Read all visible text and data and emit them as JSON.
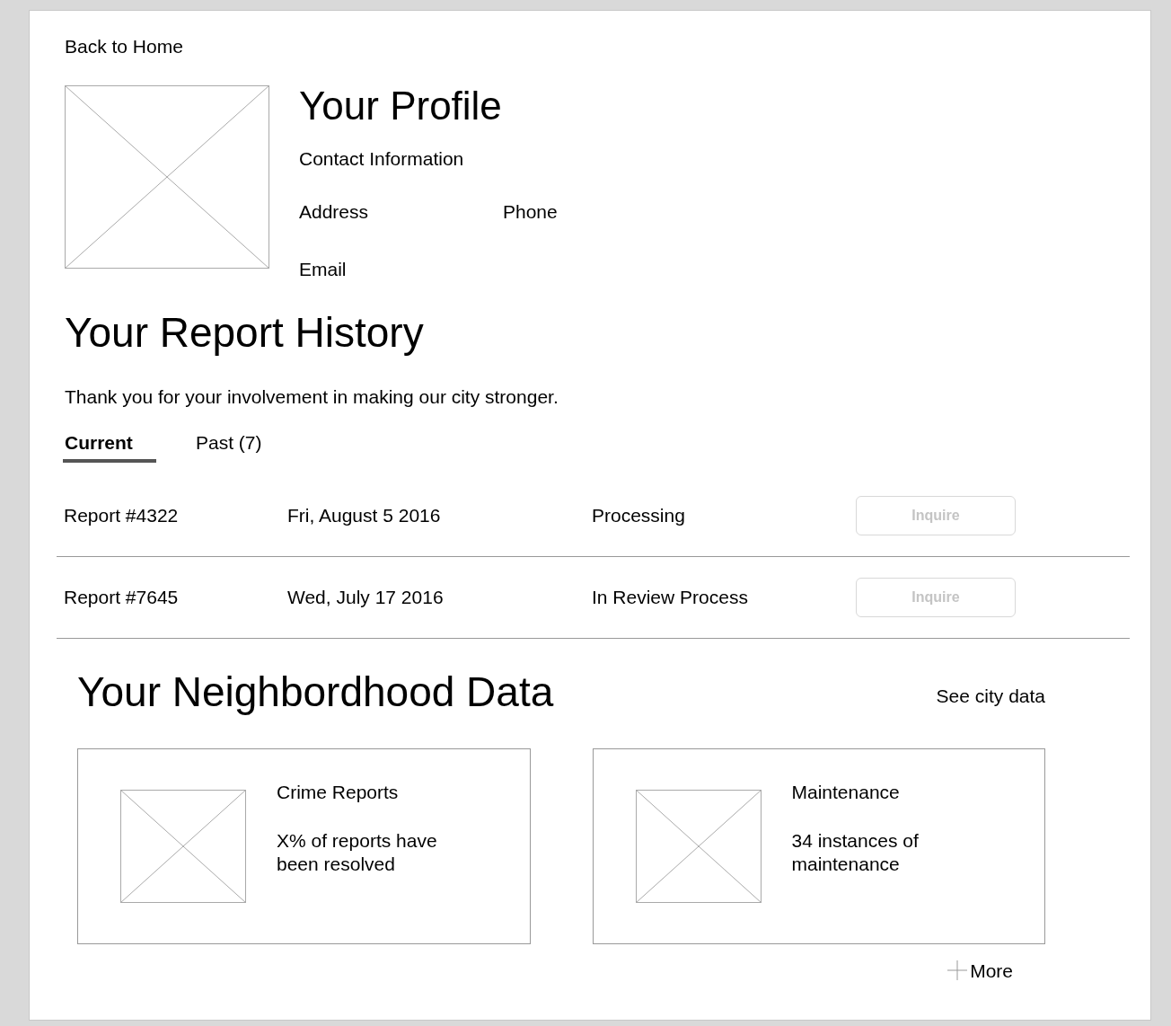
{
  "back_link": "Back to Home",
  "profile": {
    "title": "Your Profile",
    "subtitle": "Contact Information",
    "fields": [
      "Address",
      "Phone",
      "Email"
    ]
  },
  "report_history": {
    "title": "Your Report History",
    "intro": "Thank you for your involvement in making our city stronger.",
    "tabs": [
      {
        "label": "Current",
        "selected": true
      },
      {
        "label": "Past (7)",
        "selected": false
      }
    ],
    "rows": [
      {
        "report": "Report #4322",
        "date": "Fri, August 5 2016",
        "status": "Processing",
        "button": "Inquire",
        "disabled": true
      },
      {
        "report": "Report #7645",
        "date": "Wed, July 17 2016",
        "status": "In Review Process",
        "button": "Inquire",
        "disabled": true
      }
    ]
  },
  "neighborhood": {
    "title": "Your Neighbordhood Data",
    "link": "See city data",
    "cards": [
      {
        "title": "Crime Reports",
        "text": "X% of reports have been resolved"
      },
      {
        "title": "Maintenance",
        "text": "34 instances of maintenance"
      }
    ],
    "more": "More"
  }
}
